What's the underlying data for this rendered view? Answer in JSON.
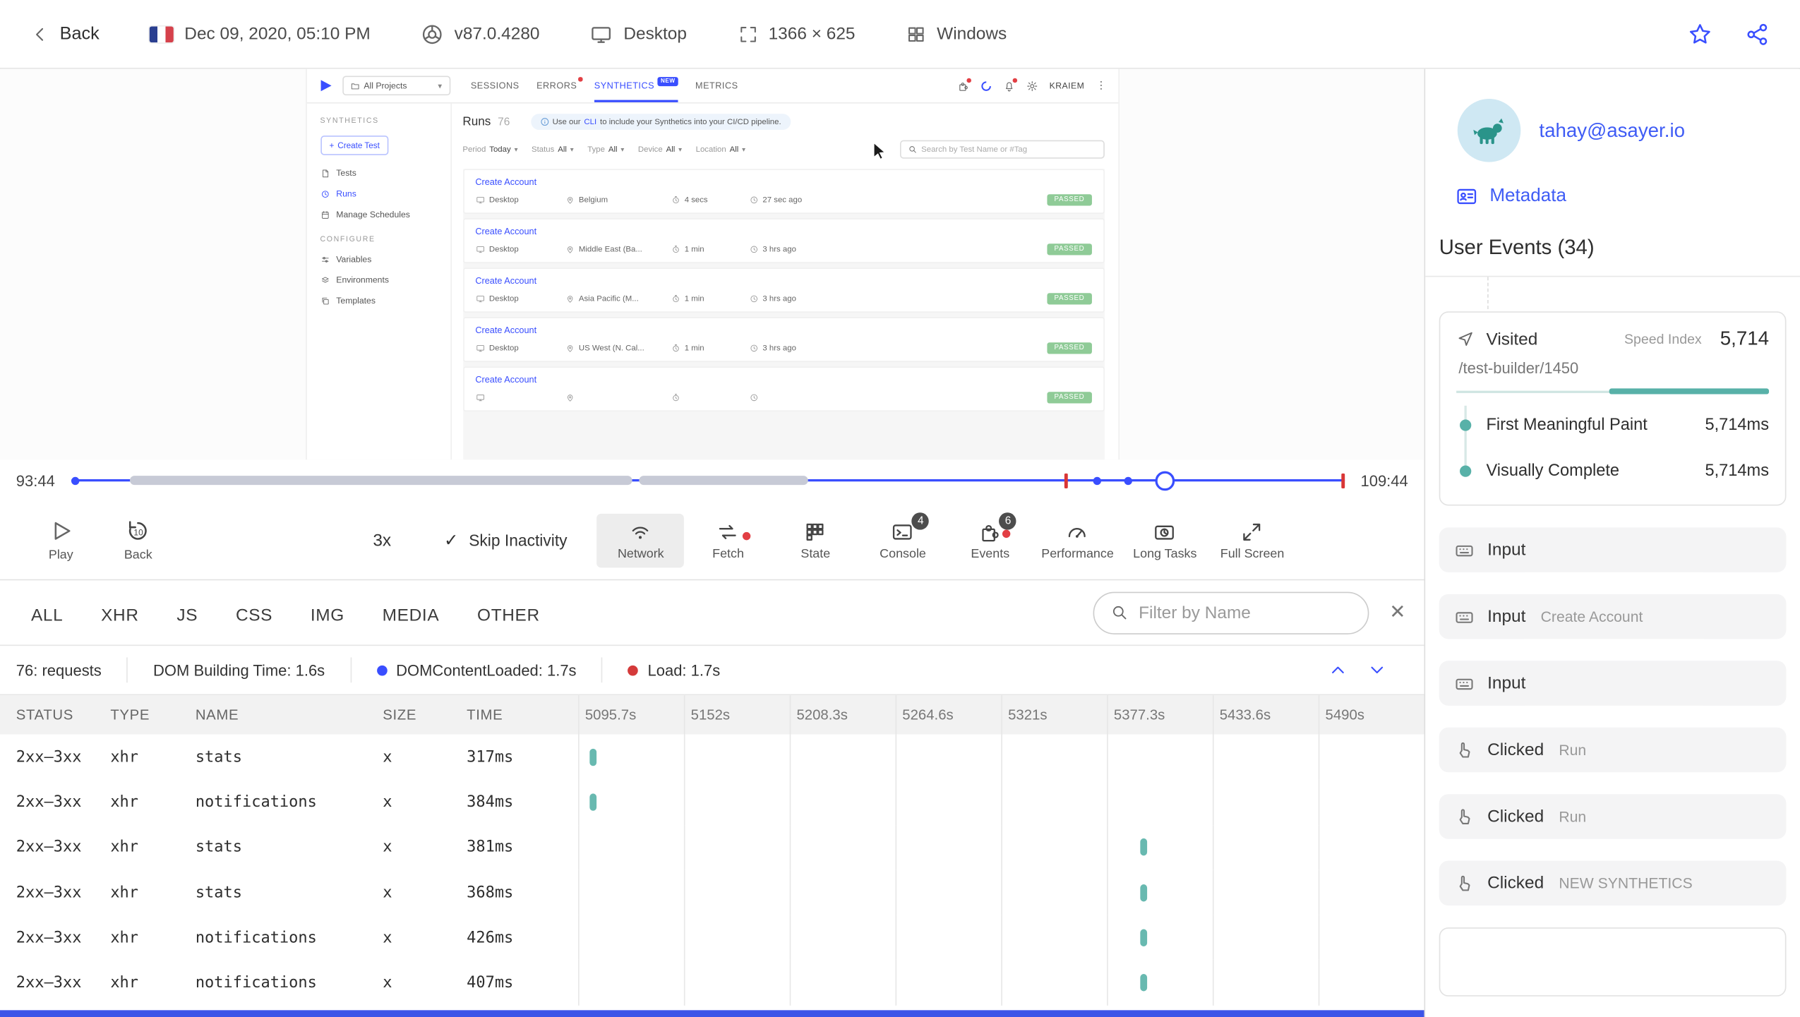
{
  "icons": {
    "caret-down": "▾",
    "info": "ⓘ",
    "check": "✓",
    "close": "✕",
    "kebab-menu": "⋮",
    "plus": "+"
  },
  "topbar": {
    "back_label": "Back",
    "date": "Dec 09, 2020, 05:10 PM",
    "browser_version": "v87.0.4280",
    "device": "Desktop",
    "resolution": "1366 × 625",
    "os": "Windows"
  },
  "replay": {
    "nav": {
      "project_selector": "All Projects",
      "tabs": [
        "SESSIONS",
        "ERRORS",
        "SYNTHETICS",
        "METRICS"
      ],
      "new_badge": "NEW",
      "user_menu": "KRAIEM"
    },
    "sidebar": {
      "section_synthetics": "SYNTHETICS",
      "create_test_label": "Create Test",
      "items": [
        "Tests",
        "Runs",
        "Manage Schedules"
      ],
      "section_configure": "CONFIGURE",
      "configure_items": [
        "Variables",
        "Environments",
        "Templates"
      ]
    },
    "content": {
      "title": "Runs",
      "count": "76",
      "banner_pre": "Use our",
      "banner_link": "CLI",
      "banner_post": "to include your Synthetics into your CI/CD pipeline.",
      "filters": [
        {
          "label": "Period",
          "value": "Today"
        },
        {
          "label": "Status",
          "value": "All"
        },
        {
          "label": "Type",
          "value": "All"
        },
        {
          "label": "Device",
          "value": "All"
        },
        {
          "label": "Location",
          "value": "All"
        }
      ],
      "search_placeholder": "Search by Test Name or #Tag",
      "runs": [
        {
          "name": "Create Account",
          "device": "Desktop",
          "location": "Belgium",
          "duration": "4 secs",
          "ago": "27 sec ago",
          "status": "PASSED"
        },
        {
          "name": "Create Account",
          "device": "Desktop",
          "location": "Middle East (Ba...",
          "duration": "1 min",
          "ago": "3 hrs ago",
          "status": "PASSED"
        },
        {
          "name": "Create Account",
          "device": "Desktop",
          "location": "Asia Pacific (M...",
          "duration": "1 min",
          "ago": "3 hrs ago",
          "status": "PASSED"
        },
        {
          "name": "Create Account",
          "device": "Desktop",
          "location": "US West (N. Cal...",
          "duration": "1 min",
          "ago": "3 hrs ago",
          "status": "PASSED"
        },
        {
          "name": "Create Account",
          "device": "",
          "location": "",
          "duration": "",
          "ago": "",
          "status": "PASSED"
        }
      ]
    }
  },
  "timeline": {
    "elapsed": "93:44",
    "duration": "109:44"
  },
  "controls": {
    "play_label": "Play",
    "back_label": "Back",
    "speed": "3x",
    "skip_inactivity": "Skip Inactivity",
    "buttons": [
      {
        "label": "Network"
      },
      {
        "label": "Fetch"
      },
      {
        "label": "State"
      },
      {
        "label": "Console",
        "badge": "4"
      },
      {
        "label": "Events",
        "badge": "6"
      },
      {
        "label": "Performance"
      },
      {
        "label": "Long Tasks"
      },
      {
        "label": "Full Screen"
      }
    ]
  },
  "network": {
    "tabs": [
      "ALL",
      "XHR",
      "JS",
      "CSS",
      "IMG",
      "MEDIA",
      "OTHER"
    ],
    "filter_placeholder": "Filter by Name",
    "stats": {
      "requests": "76: requests",
      "dom_building": "DOM Building Time: 1.6s",
      "dom_content_loaded": "DOMContentLoaded: 1.7s",
      "load": "Load: 1.7s"
    },
    "columns": [
      "STATUS",
      "TYPE",
      "NAME",
      "SIZE",
      "TIME"
    ],
    "time_columns": [
      "5095.7s",
      "5152s",
      "5208.3s",
      "5264.6s",
      "5321s",
      "5377.3s",
      "5433.6s",
      "5490s"
    ],
    "rows": [
      {
        "status": "2xx–3xx",
        "type": "xhr",
        "name": "stats",
        "size": "x",
        "time": "317ms",
        "bar_pct": 1.3
      },
      {
        "status": "2xx–3xx",
        "type": "xhr",
        "name": "notifications",
        "size": "x",
        "time": "384ms",
        "bar_pct": 1.3
      },
      {
        "status": "2xx–3xx",
        "type": "xhr",
        "name": "stats",
        "size": "x",
        "time": "381ms",
        "bar_pct": 66.5
      },
      {
        "status": "2xx–3xx",
        "type": "xhr",
        "name": "stats",
        "size": "x",
        "time": "368ms",
        "bar_pct": 66.5
      },
      {
        "status": "2xx–3xx",
        "type": "xhr",
        "name": "notifications",
        "size": "x",
        "time": "426ms",
        "bar_pct": 66.5
      },
      {
        "status": "2xx–3xx",
        "type": "xhr",
        "name": "notifications",
        "size": "x",
        "time": "407ms",
        "bar_pct": 66.5
      }
    ]
  },
  "user_panel": {
    "email": "tahay@asayer.io",
    "metadata_label": "Metadata",
    "events_title": "User Events (34)",
    "visited": {
      "label": "Visited",
      "speed_index_label": "Speed Index",
      "speed_index": "5,714",
      "url": "/test-builder/1450",
      "metrics": [
        {
          "label": "First Meaningful Paint",
          "value": "5,714ms"
        },
        {
          "label": "Visually Complete",
          "value": "5,714ms"
        }
      ]
    },
    "events": [
      {
        "label": "Input",
        "detail": "",
        "is_input": true
      },
      {
        "label": "Input",
        "detail": "Create Account",
        "is_input": true
      },
      {
        "label": "Input",
        "detail": "",
        "is_input": true
      },
      {
        "label": "Clicked",
        "detail": "Run",
        "is_click": true
      },
      {
        "label": "Clicked",
        "detail": "Run",
        "is_click": true
      },
      {
        "label": "Clicked",
        "detail": "NEW SYNTHETICS",
        "is_click": true
      }
    ]
  }
}
